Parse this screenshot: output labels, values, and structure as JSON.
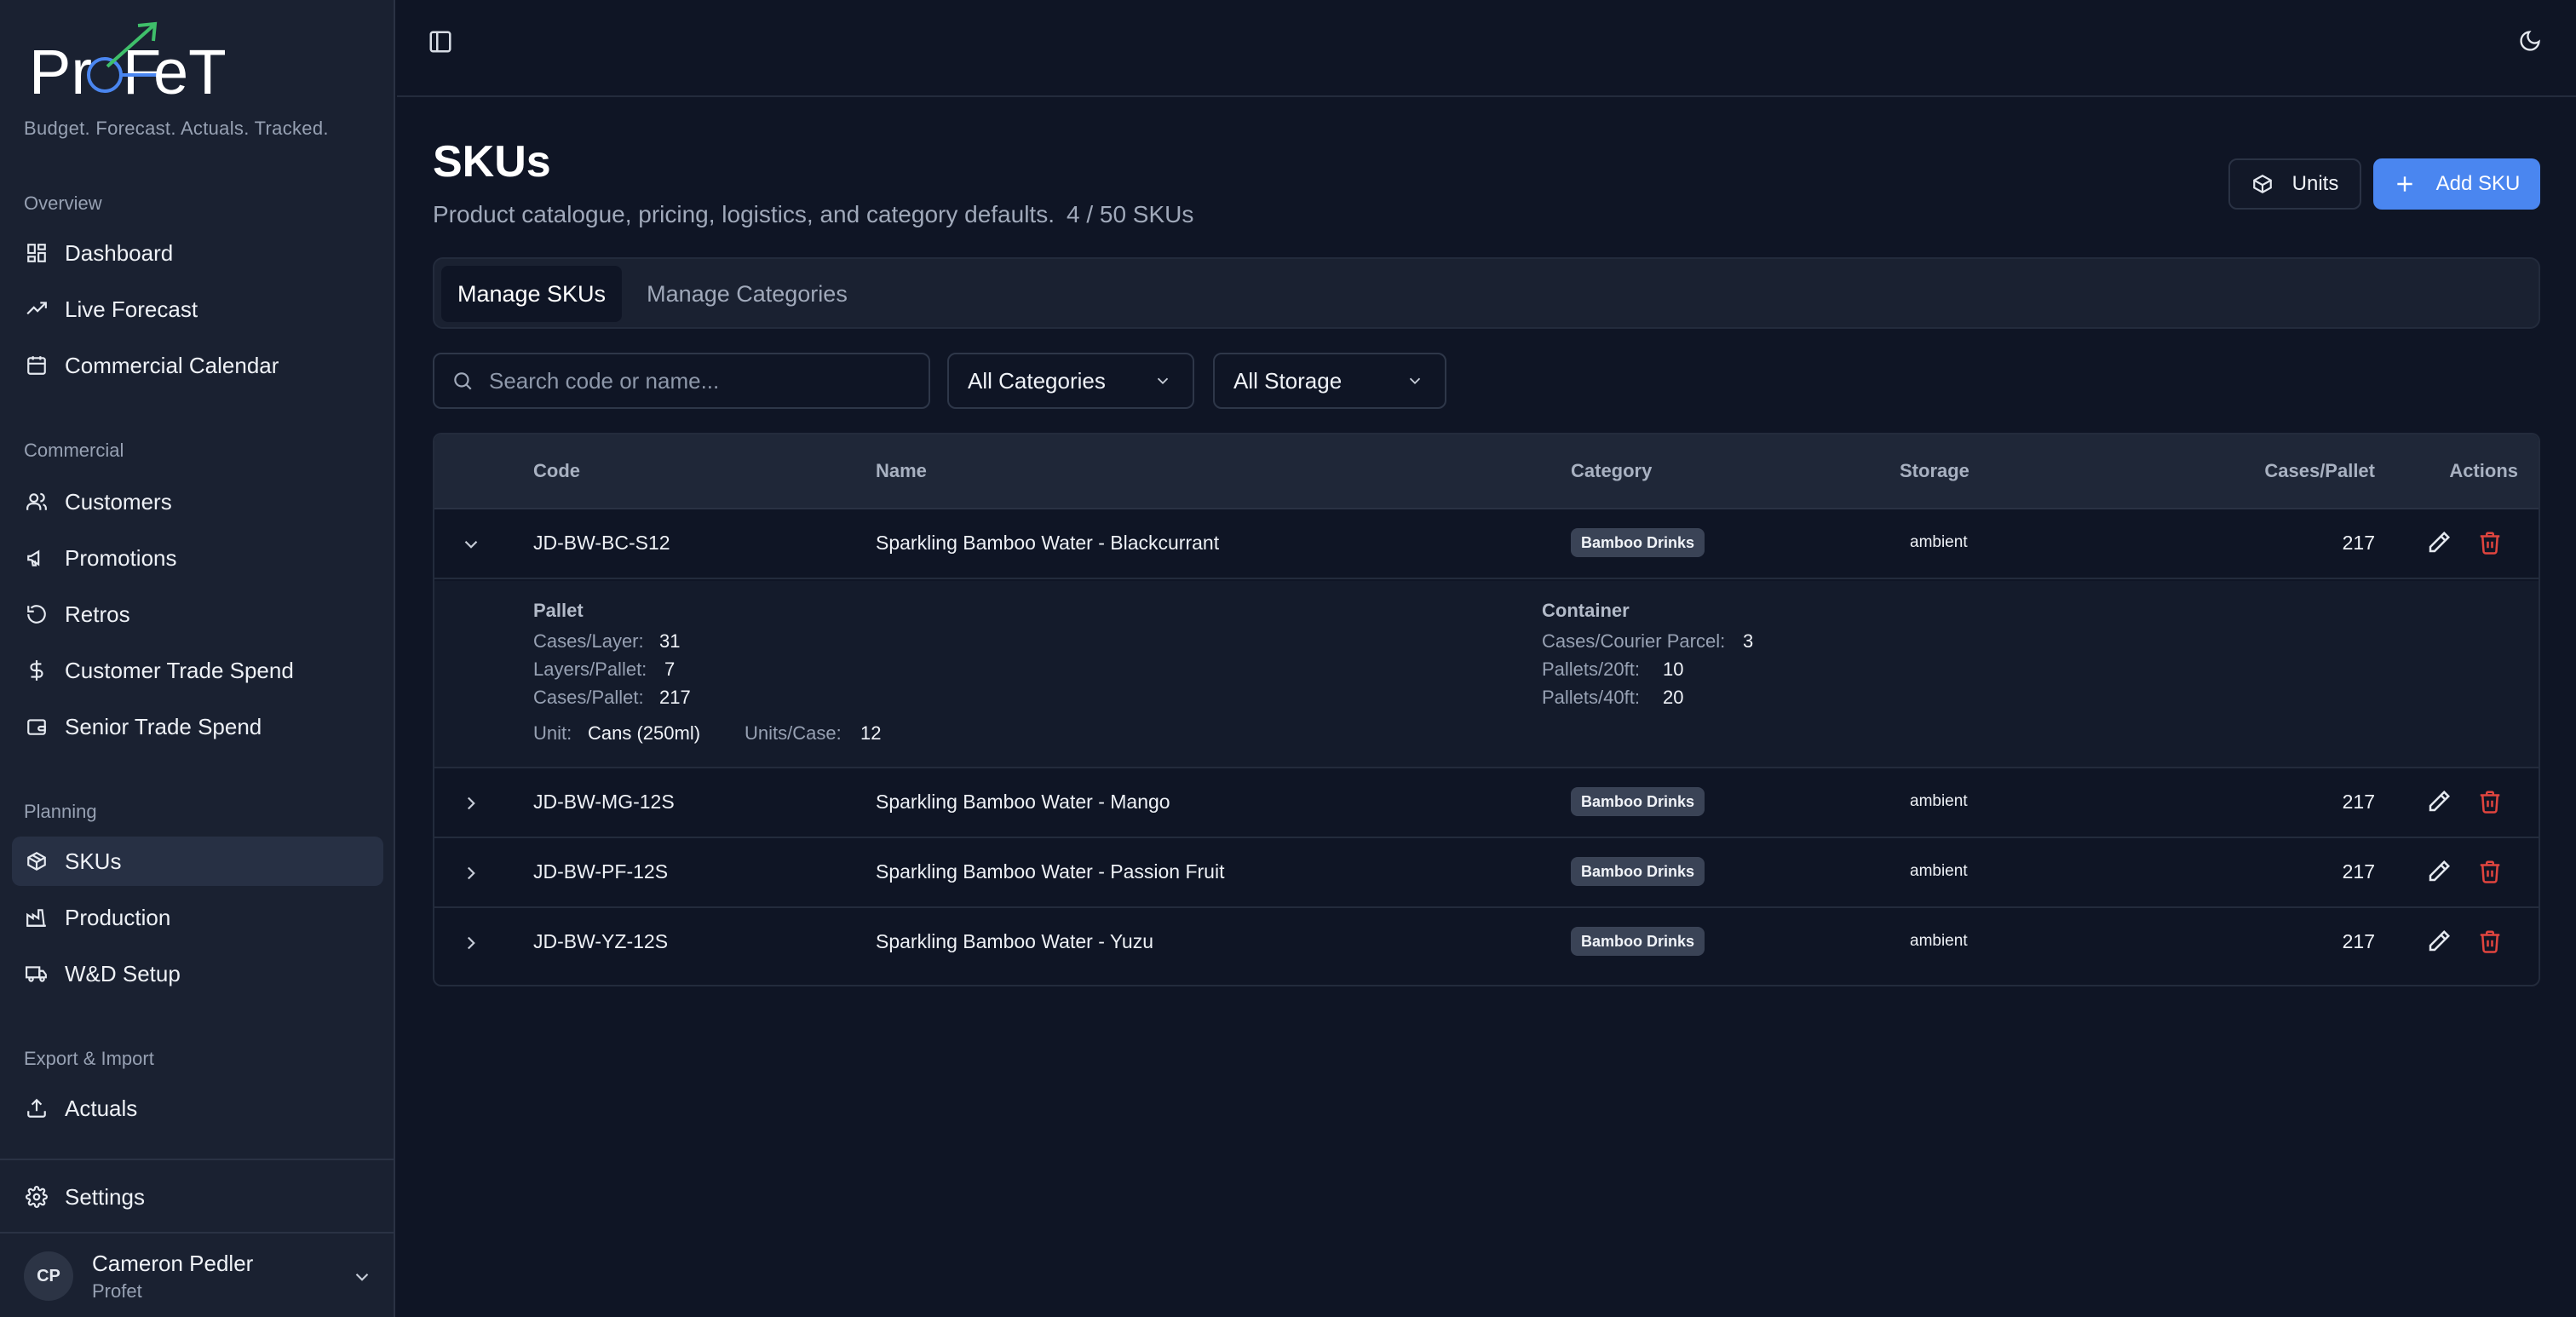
{
  "brand": {
    "logo_text": "ProFeT",
    "tagline": "Budget. Forecast. Actuals. Tracked."
  },
  "sidebar": {
    "groups": [
      {
        "heading": "Overview",
        "items": [
          {
            "label": "Dashboard",
            "icon": "dashboard-icon"
          },
          {
            "label": "Live Forecast",
            "icon": "trending-up-icon"
          },
          {
            "label": "Commercial Calendar",
            "icon": "calendar-icon"
          }
        ]
      },
      {
        "heading": "Commercial",
        "items": [
          {
            "label": "Customers",
            "icon": "users-icon"
          },
          {
            "label": "Promotions",
            "icon": "megaphone-icon"
          },
          {
            "label": "Retros",
            "icon": "rotate-ccw-icon"
          },
          {
            "label": "Customer Trade Spend",
            "icon": "dollar-sign-icon"
          },
          {
            "label": "Senior Trade Spend",
            "icon": "wallet-icon"
          }
        ]
      },
      {
        "heading": "Planning",
        "items": [
          {
            "label": "SKUs",
            "icon": "package-icon",
            "active": true
          },
          {
            "label": "Production",
            "icon": "factory-icon"
          },
          {
            "label": "W&D Setup",
            "icon": "truck-icon"
          }
        ]
      },
      {
        "heading": "Export & Import",
        "items": [
          {
            "label": "Actuals",
            "icon": "upload-icon"
          }
        ]
      }
    ],
    "settings_label": "Settings",
    "user": {
      "initials": "CP",
      "name": "Cameron Pedler",
      "org": "Profet"
    }
  },
  "page": {
    "title": "SKUs",
    "subtitle": "Product catalogue, pricing, logistics, and category defaults.",
    "count": "4 / 50 SKUs",
    "units_button": "Units",
    "add_button": "Add SKU"
  },
  "tabs": [
    {
      "label": "Manage SKUs",
      "active": true
    },
    {
      "label": "Manage Categories",
      "active": false
    }
  ],
  "filters": {
    "search_placeholder": "Search code or name...",
    "category_value": "All Categories",
    "storage_value": "All Storage"
  },
  "table": {
    "columns": [
      "Code",
      "Name",
      "Category",
      "Storage",
      "Cases/Pallet",
      "Actions"
    ],
    "rows": [
      {
        "code": "JD-BW-BC-S12",
        "name": "Sparkling Bamboo Water - Blackcurrant",
        "category": "Bamboo Drinks",
        "storage": "ambient",
        "cases_per_pallet": "217",
        "expanded": true
      },
      {
        "code": "JD-BW-MG-12S",
        "name": "Sparkling Bamboo Water - Mango",
        "category": "Bamboo Drinks",
        "storage": "ambient",
        "cases_per_pallet": "217",
        "expanded": false
      },
      {
        "code": "JD-BW-PF-12S",
        "name": "Sparkling Bamboo Water - Passion Fruit",
        "category": "Bamboo Drinks",
        "storage": "ambient",
        "cases_per_pallet": "217",
        "expanded": false
      },
      {
        "code": "JD-BW-YZ-12S",
        "name": "Sparkling Bamboo Water - Yuzu",
        "category": "Bamboo Drinks",
        "storage": "ambient",
        "cases_per_pallet": "217",
        "expanded": false
      }
    ],
    "detail": {
      "pallet_heading": "Pallet",
      "pallet": [
        {
          "label": "Cases/Layer:",
          "value": "31"
        },
        {
          "label": "Layers/Pallet:",
          "value": "7"
        },
        {
          "label": "Cases/Pallet:",
          "value": "217"
        }
      ],
      "unit_label": "Unit:",
      "unit_value": "Cans (250ml)",
      "units_case_label": "Units/Case:",
      "units_case_value": "12",
      "container_heading": "Container",
      "container": [
        {
          "label": "Cases/Courier Parcel:",
          "value": "3"
        },
        {
          "label": "Pallets/20ft:",
          "value": "10"
        },
        {
          "label": "Pallets/40ft:",
          "value": "20"
        }
      ]
    }
  },
  "colors": {
    "background": "#0f1525",
    "sidebar": "#1a2131",
    "accent": "#4a86f0",
    "danger": "#e0453f",
    "logo_green": "#3fbf6a",
    "logo_blue": "#4a86f0"
  }
}
